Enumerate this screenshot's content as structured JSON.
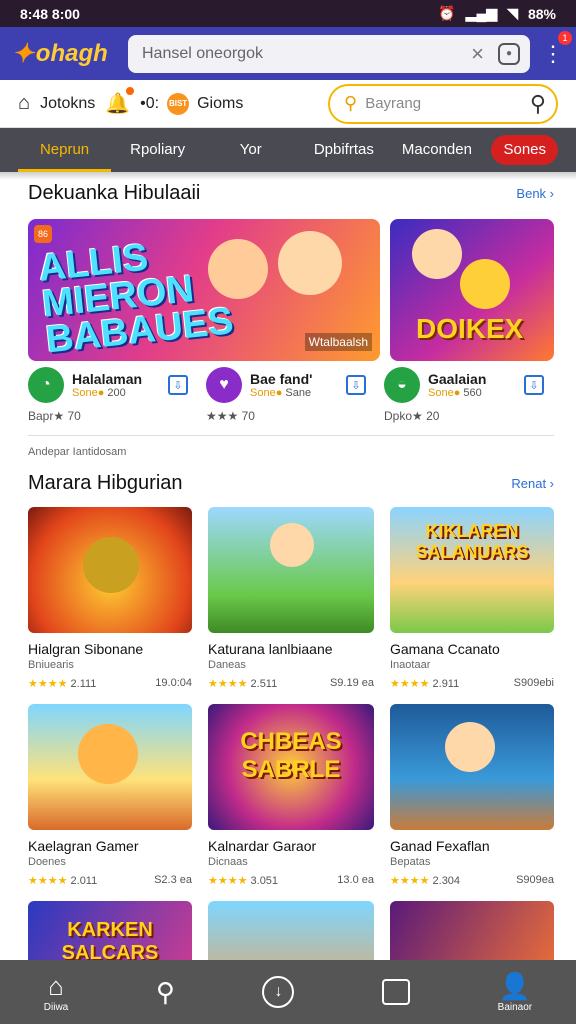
{
  "status": {
    "time": "8:48 8:00",
    "right": "88%"
  },
  "appbar": {
    "logo": "ohagh",
    "search_value": "Hansel oneorgok"
  },
  "row2": {
    "jokers": "Jotokns",
    "gioms": "Gioms",
    "coin_label": "BIST",
    "search_placeholder": "Bayrang",
    "counter": "•0:"
  },
  "tabs": [
    {
      "label": "Neprun",
      "active": true
    },
    {
      "label": "Rpoliary"
    },
    {
      "label": "Yor"
    },
    {
      "label": "Dpbifrtas"
    },
    {
      "label": "Maconden"
    },
    {
      "label": "Sones",
      "pill": true
    }
  ],
  "section1": {
    "title": "Dekuanka Hibulaaii",
    "more": "Benk ›"
  },
  "featured": {
    "big_title_l1": "ALLIS",
    "big_title_l2": "MIERON",
    "big_title_l3": "BABAUES",
    "big_sub": "Wtalbaalsh",
    "small_title": "DOIKEX"
  },
  "apps": [
    {
      "name": "Halalaman",
      "meta": "Sone●",
      "meta2": "200",
      "foot": "Bapr★ 70",
      "color": "#25a244",
      "icon": "◔"
    },
    {
      "name": "Bae fand'",
      "meta": "Sone●",
      "meta2": "Sane",
      "foot": "★★★ 70",
      "color": "#8a2cc8",
      "icon": "♥"
    },
    {
      "name": "Gaalaian",
      "meta": "Sone●",
      "meta2": "560",
      "foot": "Dpko★ 20",
      "color": "#25a244",
      "icon": "◒"
    }
  ],
  "note": "Andepar Iantidosam",
  "section2": {
    "title": "Marara Hibgurian",
    "more": "Renat ›"
  },
  "games": [
    {
      "name": "Hialgran Sibonane",
      "sub": "Bniuearis",
      "rating": "★★★★",
      "count": "2.111",
      "size": "19.0:04",
      "cls": "g1",
      "ovl": ""
    },
    {
      "name": "Katurana lanlbiaane",
      "sub": "Daneas",
      "rating": "★★★★",
      "count": "2.511",
      "size": "S9.19 ea",
      "cls": "g2",
      "ovl": ""
    },
    {
      "name": "Gamana Ccanato",
      "sub": "Inaotaar",
      "rating": "★★★★",
      "count": "2.911",
      "size": "S909ebi",
      "cls": "g3",
      "ovl": "KIKLAREN SALANUARS"
    },
    {
      "name": "Kaelagran Gamer",
      "sub": "Doenes",
      "rating": "★★★★",
      "count": "2.011",
      "size": "S2.3 ea",
      "cls": "g4",
      "ovl": ""
    },
    {
      "name": "Kalnardar Garaor",
      "sub": "Dicnaas",
      "rating": "★★★★",
      "count": "3.051",
      "size": "13.0 ea",
      "cls": "g5",
      "ovl": "CHBEAS SABRLE"
    },
    {
      "name": "Ganad Fexaflan",
      "sub": "Bepatas",
      "rating": "★★★★",
      "count": "2.304",
      "size": "S909ea",
      "cls": "g6",
      "ovl": ""
    },
    {
      "name": "",
      "sub": "",
      "rating": "",
      "count": "",
      "size": "",
      "cls": "g7",
      "ovl": "KARKEN SALCARS"
    },
    {
      "name": "",
      "sub": "",
      "rating": "",
      "count": "",
      "size": "",
      "cls": "g8",
      "ovl": ""
    },
    {
      "name": "",
      "sub": "",
      "rating": "",
      "count": "",
      "size": "",
      "cls": "g9",
      "ovl": ""
    }
  ],
  "nav": [
    {
      "icon": "⌂",
      "label": "Diiwa"
    },
    {
      "icon": "⚲",
      "label": ""
    },
    {
      "icon": "↓",
      "label": ""
    },
    {
      "icon": "▢",
      "label": ""
    },
    {
      "icon": "👤",
      "label": "Bainaor"
    }
  ]
}
